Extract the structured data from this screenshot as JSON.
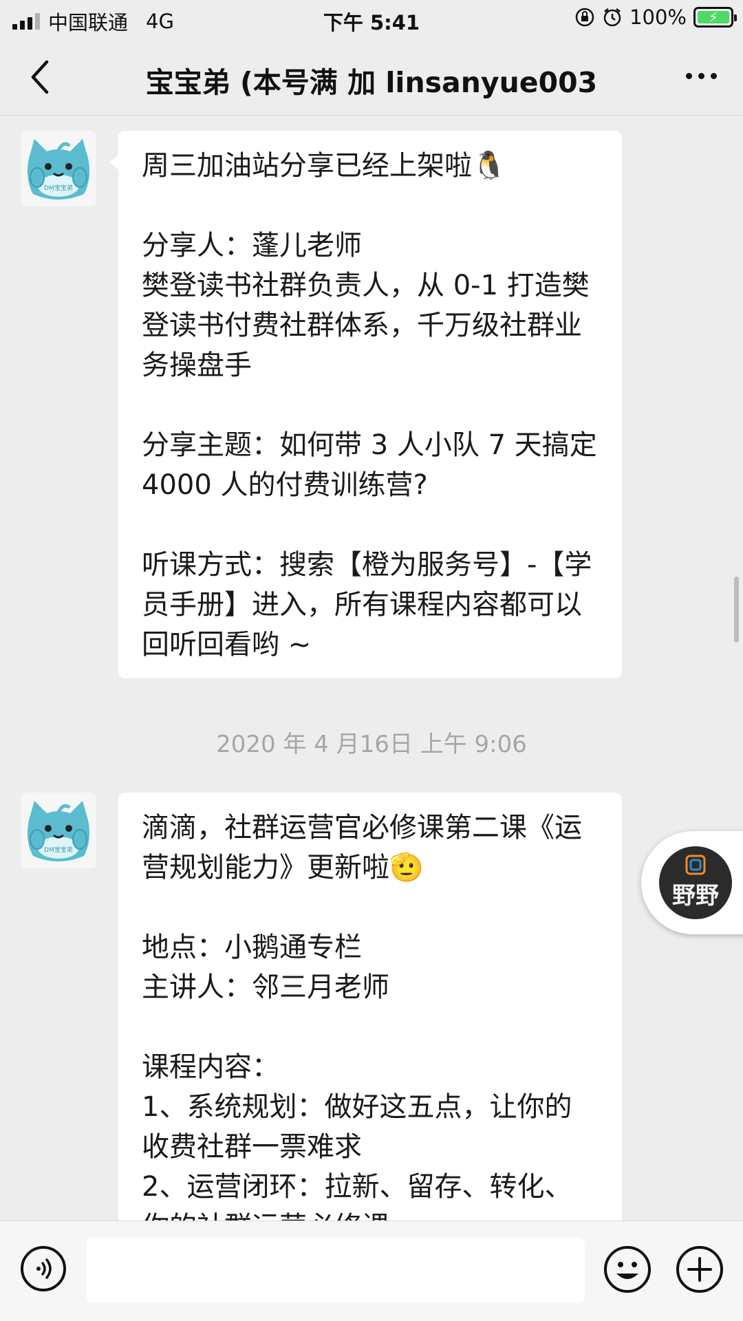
{
  "status_bar": {
    "carrier": "中国联通",
    "network": "4G",
    "time": "下午 5:41",
    "battery": "100%",
    "icons": [
      "signal-icon",
      "orientation-lock-icon",
      "alarm-icon",
      "battery-charging-icon"
    ]
  },
  "nav": {
    "title": "宝宝弟 (本号满 加 linsanyue003",
    "back_icon": "chevron-left-icon",
    "more_icon": "more-dots-icon"
  },
  "avatar_caption": "DM宝宝弟",
  "messages": [
    {
      "sender": "宝宝弟",
      "emoji": "🐧",
      "paragraphs": [
        "周三加油站分享已经上架啦",
        "分享人：蓬儿老师\n樊登读书社群负责人，从 0-1 打造樊登读书付费社群体系，千万级社群业务操盘手",
        "分享主题：如何带 3 人小队 7 天搞定 4000 人的付费训练营?",
        "听课方式：搜索【橙为服务号】-【学员手册】进入，所有课程内容都可以回听回看哟 ~"
      ]
    },
    {
      "sender": "宝宝弟",
      "emoji": "🫡",
      "paragraphs": [
        "滴滴，社群运营官必修课第二课《运营规划能力》更新啦",
        "地点：小鹅通专栏\n主讲人：邻三月老师",
        "课程内容：\n1、系统规划：做好这五点，让你的收费社群一票难求\n2、运营闭环：拉新、留存、转化、你的社群运营必修课"
      ]
    }
  ],
  "timestamp": "2020 年 4 月16日 上午 9:06",
  "floating_widget": {
    "label": "野野"
  },
  "input_bar": {
    "value": "",
    "voice_icon": "voice-icon",
    "emoji_icon": "emoji-icon",
    "plus_icon": "plus-icon"
  },
  "colors": {
    "background": "#ededed",
    "bubble": "#ffffff",
    "timestamp": "#a6a6a6",
    "battery": "#4cd964",
    "avatar_teal": "#5bbcd0"
  }
}
